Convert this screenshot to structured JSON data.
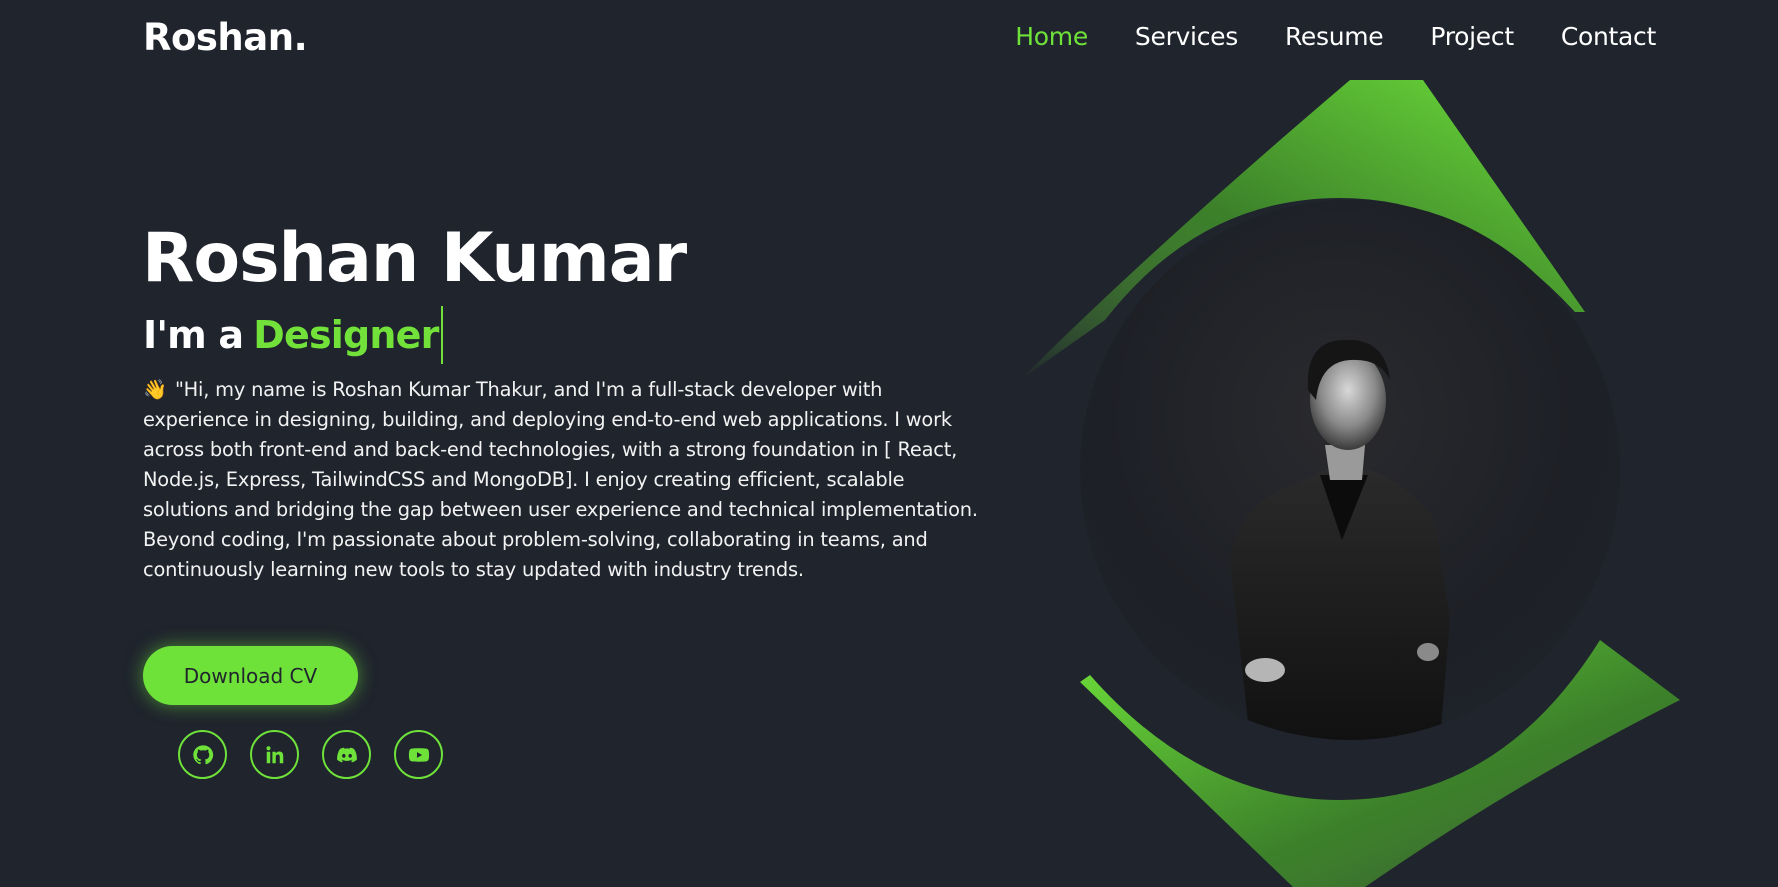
{
  "header": {
    "logo": "Roshan.",
    "nav": [
      {
        "label": "Home",
        "active": true
      },
      {
        "label": "Services",
        "active": false
      },
      {
        "label": "Resume",
        "active": false
      },
      {
        "label": "Project",
        "active": false
      },
      {
        "label": "Contact",
        "active": false
      }
    ]
  },
  "hero": {
    "name": "Roshan Kumar",
    "role_prefix": "I'm a",
    "role_word": "Designer",
    "bio_emoji": "👋",
    "bio": "\"Hi, my name is Roshan Kumar Thakur, and I'm a full-stack developer with experience in designing, building, and deploying end-to-end web applications. I work across both front-end and back-end technologies, with a strong foundation in [ React, Node.js, Express, TailwindCSS and MongoDB]. I enjoy creating efficient, scalable solutions and bridging the gap between user experience and technical implementation. Beyond coding, I'm passionate about problem-solving, collaborating in teams, and continuously learning new tools to stay updated with industry trends.",
    "cta_label": "Download CV"
  },
  "socials": [
    {
      "icon": "github-icon"
    },
    {
      "icon": "linkedin-icon"
    },
    {
      "icon": "discord-icon"
    },
    {
      "icon": "youtube-icon"
    }
  ],
  "colors": {
    "background": "#1f242d",
    "accent": "#6fe23a",
    "text": "#ffffff"
  }
}
